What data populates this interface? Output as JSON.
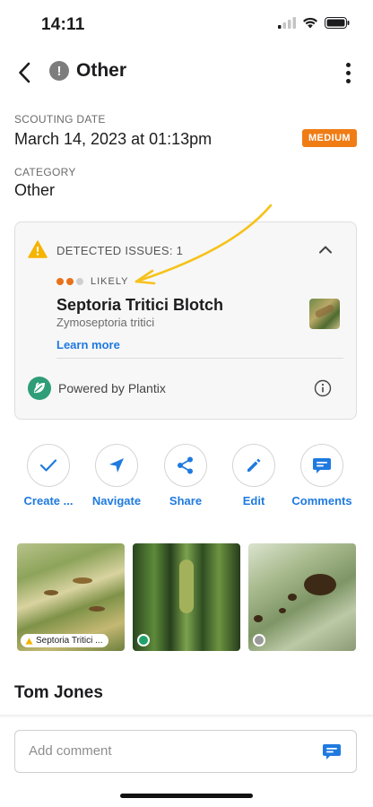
{
  "status_bar": {
    "time": "14:11",
    "icons": [
      "cellular-signal-icon",
      "wifi-icon",
      "battery-icon"
    ]
  },
  "nav": {
    "title": "Other",
    "title_badge": "!",
    "back_icon": "chevron-left-icon",
    "more_icon": "vertical-ellipsis-icon"
  },
  "scouting": {
    "date_label": "SCOUTING DATE",
    "date_value": "March 14, 2023 at 01:13pm",
    "severity": "MEDIUM",
    "severity_color": "#f07c16",
    "category_label": "CATEGORY",
    "category_value": "Other"
  },
  "issues": {
    "header": "DETECTED ISSUES: 1",
    "warning_color": "#f5b400",
    "likelihood": "LIKELY",
    "likelihood_level": 2,
    "likelihood_max": 3,
    "likelihood_color": "#e8711a",
    "name": "Septoria Tritici Blotch",
    "scientific_name": "Zymoseptoria tritici",
    "learn_more": "Learn more",
    "powered_by": "Powered by Plantix"
  },
  "actions": [
    {
      "label": "Create ...",
      "icon": "checkmark-icon"
    },
    {
      "label": "Navigate",
      "icon": "navigation-arrow-icon"
    },
    {
      "label": "Share",
      "icon": "share-icon"
    },
    {
      "label": "Edit",
      "icon": "pencil-icon"
    },
    {
      "label": "Comments",
      "icon": "comment-bubble-icon"
    }
  ],
  "photos": [
    {
      "tag": "Septoria Tritici ..."
    },
    {
      "status_color": "#1fa36a"
    },
    {
      "status_color": "#9a9a9a"
    }
  ],
  "author": "Tom Jones",
  "comment": {
    "placeholder": "Add comment"
  },
  "accent_color": "#1f7ae0"
}
